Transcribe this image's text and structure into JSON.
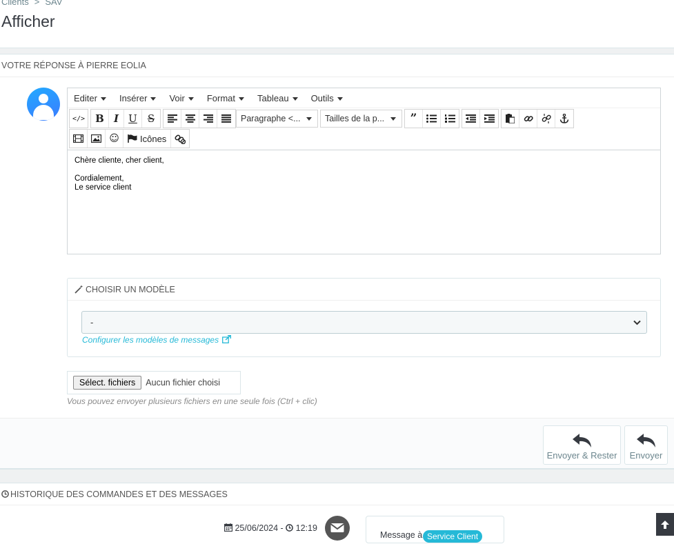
{
  "breadcrumb": {
    "parent": "Clients",
    "separator": ">",
    "current": "SAV"
  },
  "page": {
    "title": "Afficher"
  },
  "reply_panel": {
    "heading": "VOTRE RÉPONSE À PIERRE EOLIA"
  },
  "editor": {
    "menu": [
      "Editer",
      "Insérer",
      "Voir",
      "Format",
      "Tableau",
      "Outils"
    ],
    "format_dropdown": "Paragraphe <...",
    "size_dropdown": "Tailles de la p...",
    "icons_label": "Icônes",
    "content": {
      "greeting": "Chère cliente, cher client,",
      "closing": "Cordialement,",
      "signature": "Le service client"
    }
  },
  "template_panel": {
    "heading": "CHOISIR UN MODÈLE",
    "select_value": "-",
    "configure_link": "Configurer les modèles de messages"
  },
  "file_upload": {
    "button_label": "Sélect. fichiers",
    "status": "Aucun fichier choisi",
    "help": "Vous pouvez envoyer plusieurs fichiers en une seule fois (Ctrl + clic)"
  },
  "actions": {
    "send_stay": "Envoyer & Rester",
    "send": "Envoyer"
  },
  "history": {
    "heading": "HISTORIQUE DES COMMANDES ET DES MESSAGES",
    "date": "25/06/2024",
    "time": "12:19",
    "message_label": "Message à",
    "badge": "Service Client"
  },
  "colors": {
    "accent": "#25b9d7",
    "text": "#363a41",
    "muted": "#6c868e"
  }
}
